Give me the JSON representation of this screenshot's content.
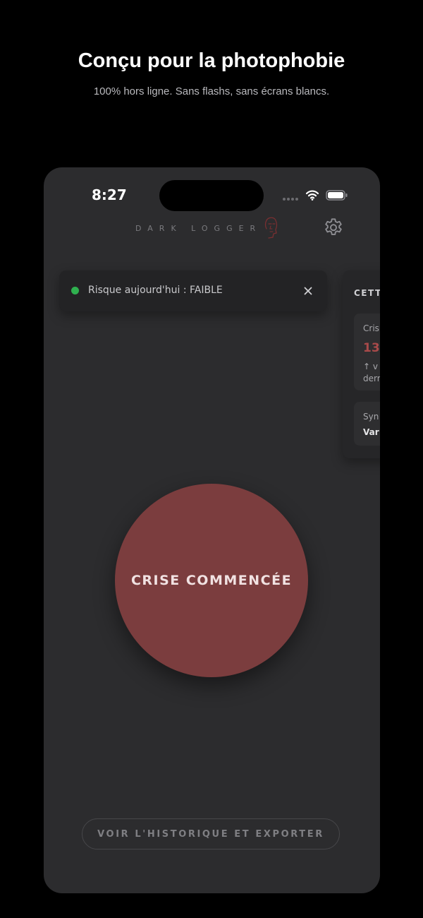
{
  "promo": {
    "headline": "Conçu pour la photophobie",
    "subheadline": "100% hors ligne. Sans flashs, sans écrans blancs."
  },
  "status_bar": {
    "time": "8:27",
    "icons": [
      "signal-dots-icon",
      "wifi-icon",
      "battery-icon"
    ]
  },
  "header": {
    "app_name": "DARK LOGGER",
    "logo_icon": "face-logo-icon",
    "settings_icon": "gear-icon"
  },
  "risk_banner": {
    "text": "Risque aujourd'hui : FAIBLE",
    "status_color": "#2fb04f",
    "close_icon": "close-icon"
  },
  "side_panel": {
    "title": "CETT",
    "card1": {
      "label": "Cris",
      "value": "13",
      "trend": "↑ v",
      "subtext": "derr"
    },
    "card2": {
      "label": "Syn",
      "value": "Var"
    }
  },
  "crisis_button": {
    "label": "CRISE COMMENCÉE",
    "color": "#7b3d3e"
  },
  "history_button": {
    "label": "VOIR L'HISTORIQUE ET EXPORTER"
  }
}
